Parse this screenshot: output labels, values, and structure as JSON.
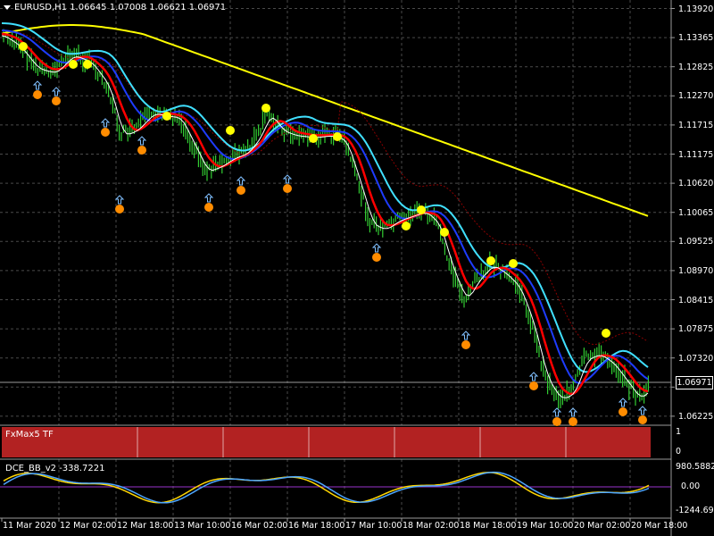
{
  "symbol_info": "EURUSD,H1  1.06645 1.07008 1.06621 1.06971",
  "main_price_axis": [
    "1.13920",
    "1.13365",
    "1.12825",
    "1.12270",
    "1.11715",
    "1.11175",
    "1.10620",
    "1.10065",
    "1.09525",
    "1.08970",
    "1.08415",
    "1.07875",
    "1.07320",
    "1.06765",
    "1.06225"
  ],
  "current_price": "1.06971",
  "fxmax_panel": {
    "label": "FxMax5 TF",
    "axis": [
      "1",
      "0"
    ],
    "bar_color": "#b22222"
  },
  "dce_panel": {
    "label": "DCE_BB_v2 -338.7221",
    "axis": [
      "980.5882",
      "0.00",
      "-1244.695"
    ]
  },
  "time_axis": [
    "11 Mar 2020",
    "12 Mar 02:00",
    "12 Mar 18:00",
    "13 Mar 10:00",
    "16 Mar 02:00",
    "16 Mar 18:00",
    "17 Mar 10:00",
    "18 Mar 02:00",
    "18 Mar 18:00",
    "19 Mar 10:00",
    "20 Mar 02:00",
    "20 Mar 18:00"
  ],
  "colors": {
    "background": "#000000",
    "grid": "#4a4a4a",
    "candles": "#32cd32",
    "ma_red": "#ff0000",
    "ma_blue": "#1e3cff",
    "ma_cyan": "#40e0ff",
    "ma_yellow": "#ffff00",
    "ma_white": "#ffffff",
    "ma_darkred_dotted": "#8b0000",
    "signal_yellow": "#ffff00",
    "signal_orange": "#ff8c00",
    "arrow": "#80c0ff",
    "dce_blue": "#4da6ff",
    "dce_yellow": "#ffd700",
    "zero_line": "#9932cc"
  }
}
